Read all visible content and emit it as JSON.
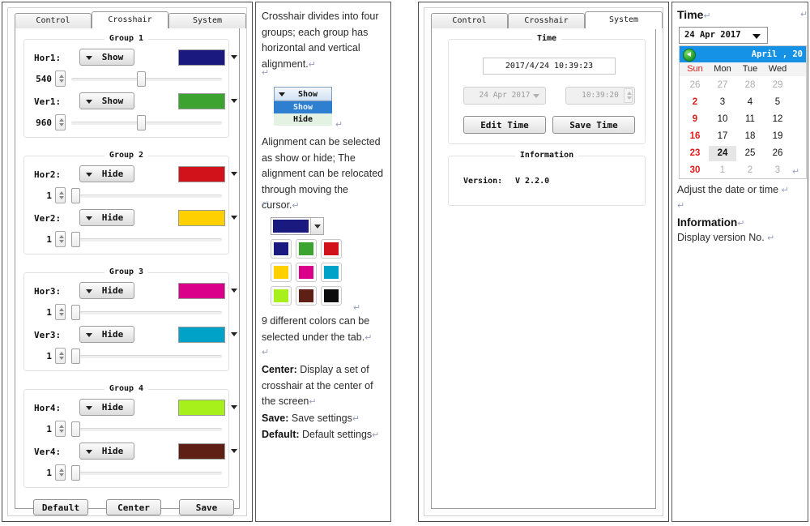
{
  "crosshair_panel": {
    "tabs": [
      {
        "label": "Control",
        "active": false
      },
      {
        "label": "Crosshair",
        "active": true
      },
      {
        "label": "System",
        "active": false
      }
    ],
    "groups": [
      {
        "title": "Group 1",
        "rows": [
          {
            "label": "Hor1:",
            "state": "Show",
            "color": "#19197F",
            "value": "540",
            "thumb_pct": 50
          },
          {
            "label": "Ver1:",
            "state": "Show",
            "color": "#3CA230",
            "value": "960",
            "thumb_pct": 50
          }
        ]
      },
      {
        "title": "Group 2",
        "rows": [
          {
            "label": "Hor2:",
            "state": "Hide",
            "color": "#D1121A",
            "value": "1",
            "thumb_pct": 0
          },
          {
            "label": "Ver2:",
            "state": "Hide",
            "color": "#FFD000",
            "value": "1",
            "thumb_pct": 0
          }
        ]
      },
      {
        "title": "Group 3",
        "rows": [
          {
            "label": "Hor3:",
            "state": "Hide",
            "color": "#DB0089",
            "value": "1",
            "thumb_pct": 0
          },
          {
            "label": "Ver3:",
            "state": "Hide",
            "color": "#00A2C8",
            "value": "1",
            "thumb_pct": 0
          }
        ]
      },
      {
        "title": "Group 4",
        "rows": [
          {
            "label": "Hor4:",
            "state": "Hide",
            "color": "#A8F01C",
            "value": "1",
            "thumb_pct": 0
          },
          {
            "label": "Ver4:",
            "state": "Hide",
            "color": "#5E2014",
            "value": "1",
            "thumb_pct": 0
          }
        ]
      }
    ],
    "buttons": [
      {
        "label": "Default"
      },
      {
        "label": "Center"
      },
      {
        "label": "Save"
      }
    ]
  },
  "crosshair_notes": {
    "para1": "Crosshair divides into four groups; each group has horizontal and vertical alignment.",
    "dropdown_demo": {
      "selected": "Show",
      "options": [
        "Show",
        "Hide"
      ]
    },
    "para2": "Alignment can be selected as show or hide; The alignment can be relocated through moving the cursor.",
    "palette_demo": {
      "selected_color": "#19197F",
      "colors": [
        "#19197F",
        "#3CA230",
        "#D1121A",
        "#FFD000",
        "#DB0089",
        "#00A2C8",
        "#A8F01C",
        "#5E2014",
        "#0B0B0B"
      ]
    },
    "para3": "9 different colors can be selected under the tab.",
    "defs": [
      {
        "term": "Center:",
        "desc": " Display a set of crosshair at the center of the screen"
      },
      {
        "term": "Save:",
        "desc": " Save settings"
      },
      {
        "term": "Default:",
        "desc": " Default settings"
      }
    ]
  },
  "system_panel": {
    "tabs": [
      {
        "label": "Control",
        "active": false
      },
      {
        "label": "Crosshair",
        "active": false
      },
      {
        "label": "System",
        "active": true
      }
    ],
    "time_group": {
      "title": "Time",
      "readout": "2017/4/24   10:39:23",
      "date_value": "24 Apr 2017",
      "time_value": "10:39:20",
      "edit_button": "Edit Time",
      "save_button": "Save Time"
    },
    "information_group": {
      "title": "Information",
      "version_label": "Version:",
      "version_value": "V 2.2.0"
    }
  },
  "system_notes": {
    "heading_time": "Time",
    "date_combo_value": "24 Apr 2017",
    "calendar": {
      "month_label": "April , 20",
      "prev_icon": "back-arrow-icon",
      "dow": [
        "Sun",
        "Mon",
        "Tue",
        "Wed"
      ],
      "weeks": [
        [
          {
            "d": "26",
            "mut": true
          },
          {
            "d": "27",
            "mut": true
          },
          {
            "d": "28",
            "mut": true
          },
          {
            "d": "29",
            "mut": true
          }
        ],
        [
          {
            "d": "2",
            "sun": true
          },
          {
            "d": "3"
          },
          {
            "d": "4"
          },
          {
            "d": "5"
          }
        ],
        [
          {
            "d": "9",
            "sun": true
          },
          {
            "d": "10"
          },
          {
            "d": "11"
          },
          {
            "d": "12"
          }
        ],
        [
          {
            "d": "16",
            "sun": true
          },
          {
            "d": "17"
          },
          {
            "d": "18"
          },
          {
            "d": "19"
          }
        ],
        [
          {
            "d": "23",
            "sun": true
          },
          {
            "d": "24",
            "sel": true
          },
          {
            "d": "25"
          },
          {
            "d": "26"
          }
        ],
        [
          {
            "d": "30",
            "sun": true
          },
          {
            "d": "1",
            "mut": true
          },
          {
            "d": "2",
            "mut": true
          },
          {
            "d": "3",
            "mut": true
          }
        ]
      ]
    },
    "adjust_text": "Adjust the date or time",
    "heading_information": "Information",
    "version_text": "Display version No."
  }
}
